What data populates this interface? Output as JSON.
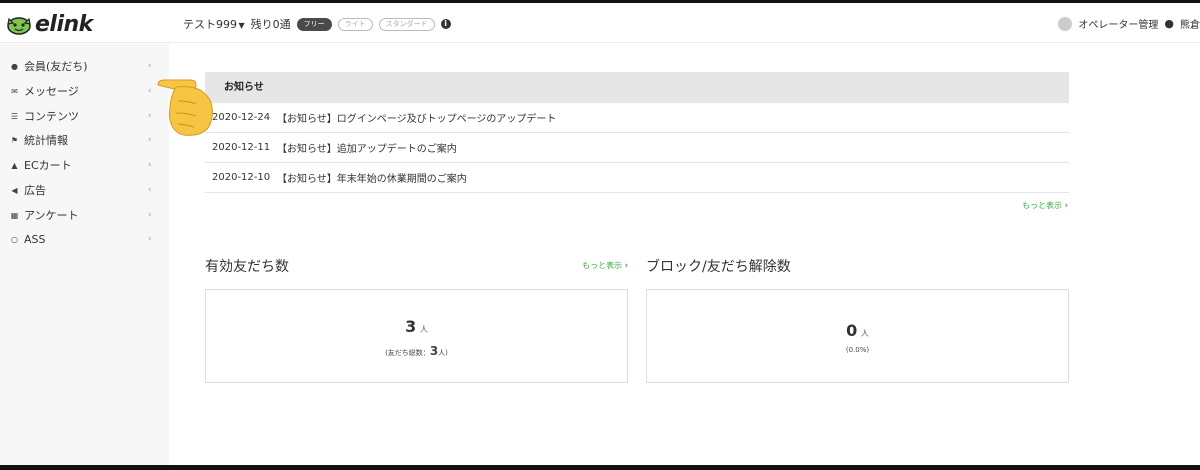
{
  "header": {
    "logo_text": "elink",
    "account_name": "テスト999",
    "remaining": "残り0通",
    "plans": [
      "フリー",
      "ライト",
      "スタンダード"
    ],
    "active_plan_index": 0,
    "operator_label": "オペレーター管理",
    "user_name": "熊倉"
  },
  "sidebar": {
    "items": [
      {
        "label": "会員(友だち)",
        "icon": "user-icon"
      },
      {
        "label": "メッセージ",
        "icon": "envelope-icon"
      },
      {
        "label": "コンテンツ",
        "icon": "list-icon"
      },
      {
        "label": "統計情報",
        "icon": "flag-icon"
      },
      {
        "label": "ECカート",
        "icon": "cart-icon"
      },
      {
        "label": "広告",
        "icon": "megaphone-icon"
      },
      {
        "label": "アンケート",
        "icon": "keyboard-icon"
      },
      {
        "label": "ASS",
        "icon": "headset-icon"
      }
    ]
  },
  "notices": {
    "title": "お知らせ",
    "rows": [
      {
        "date": "2020-12-24",
        "title": "【お知らせ】ログインページ及びトップページのアップデート"
      },
      {
        "date": "2020-12-11",
        "title": "【お知らせ】追加アップデートのご案内"
      },
      {
        "date": "2020-12-10",
        "title": "【お知らせ】年末年始の休業期間のご案内"
      }
    ],
    "more_label": "もっと表示"
  },
  "active_friends": {
    "title": "有効友だち数",
    "more_label": "もっと表示",
    "count": "3",
    "unit": "人",
    "total_label": "(友だち総数：",
    "total_value": "3",
    "total_suffix": "人)"
  },
  "blocked": {
    "title": "ブロック/友だち解除数",
    "count": "0",
    "unit": "人",
    "percent": "(0.0%)"
  },
  "colors": {
    "accent_green": "#3daa3d",
    "notice_header_bg": "#e6e6e6",
    "sidebar_bg": "#f7f7f7"
  }
}
